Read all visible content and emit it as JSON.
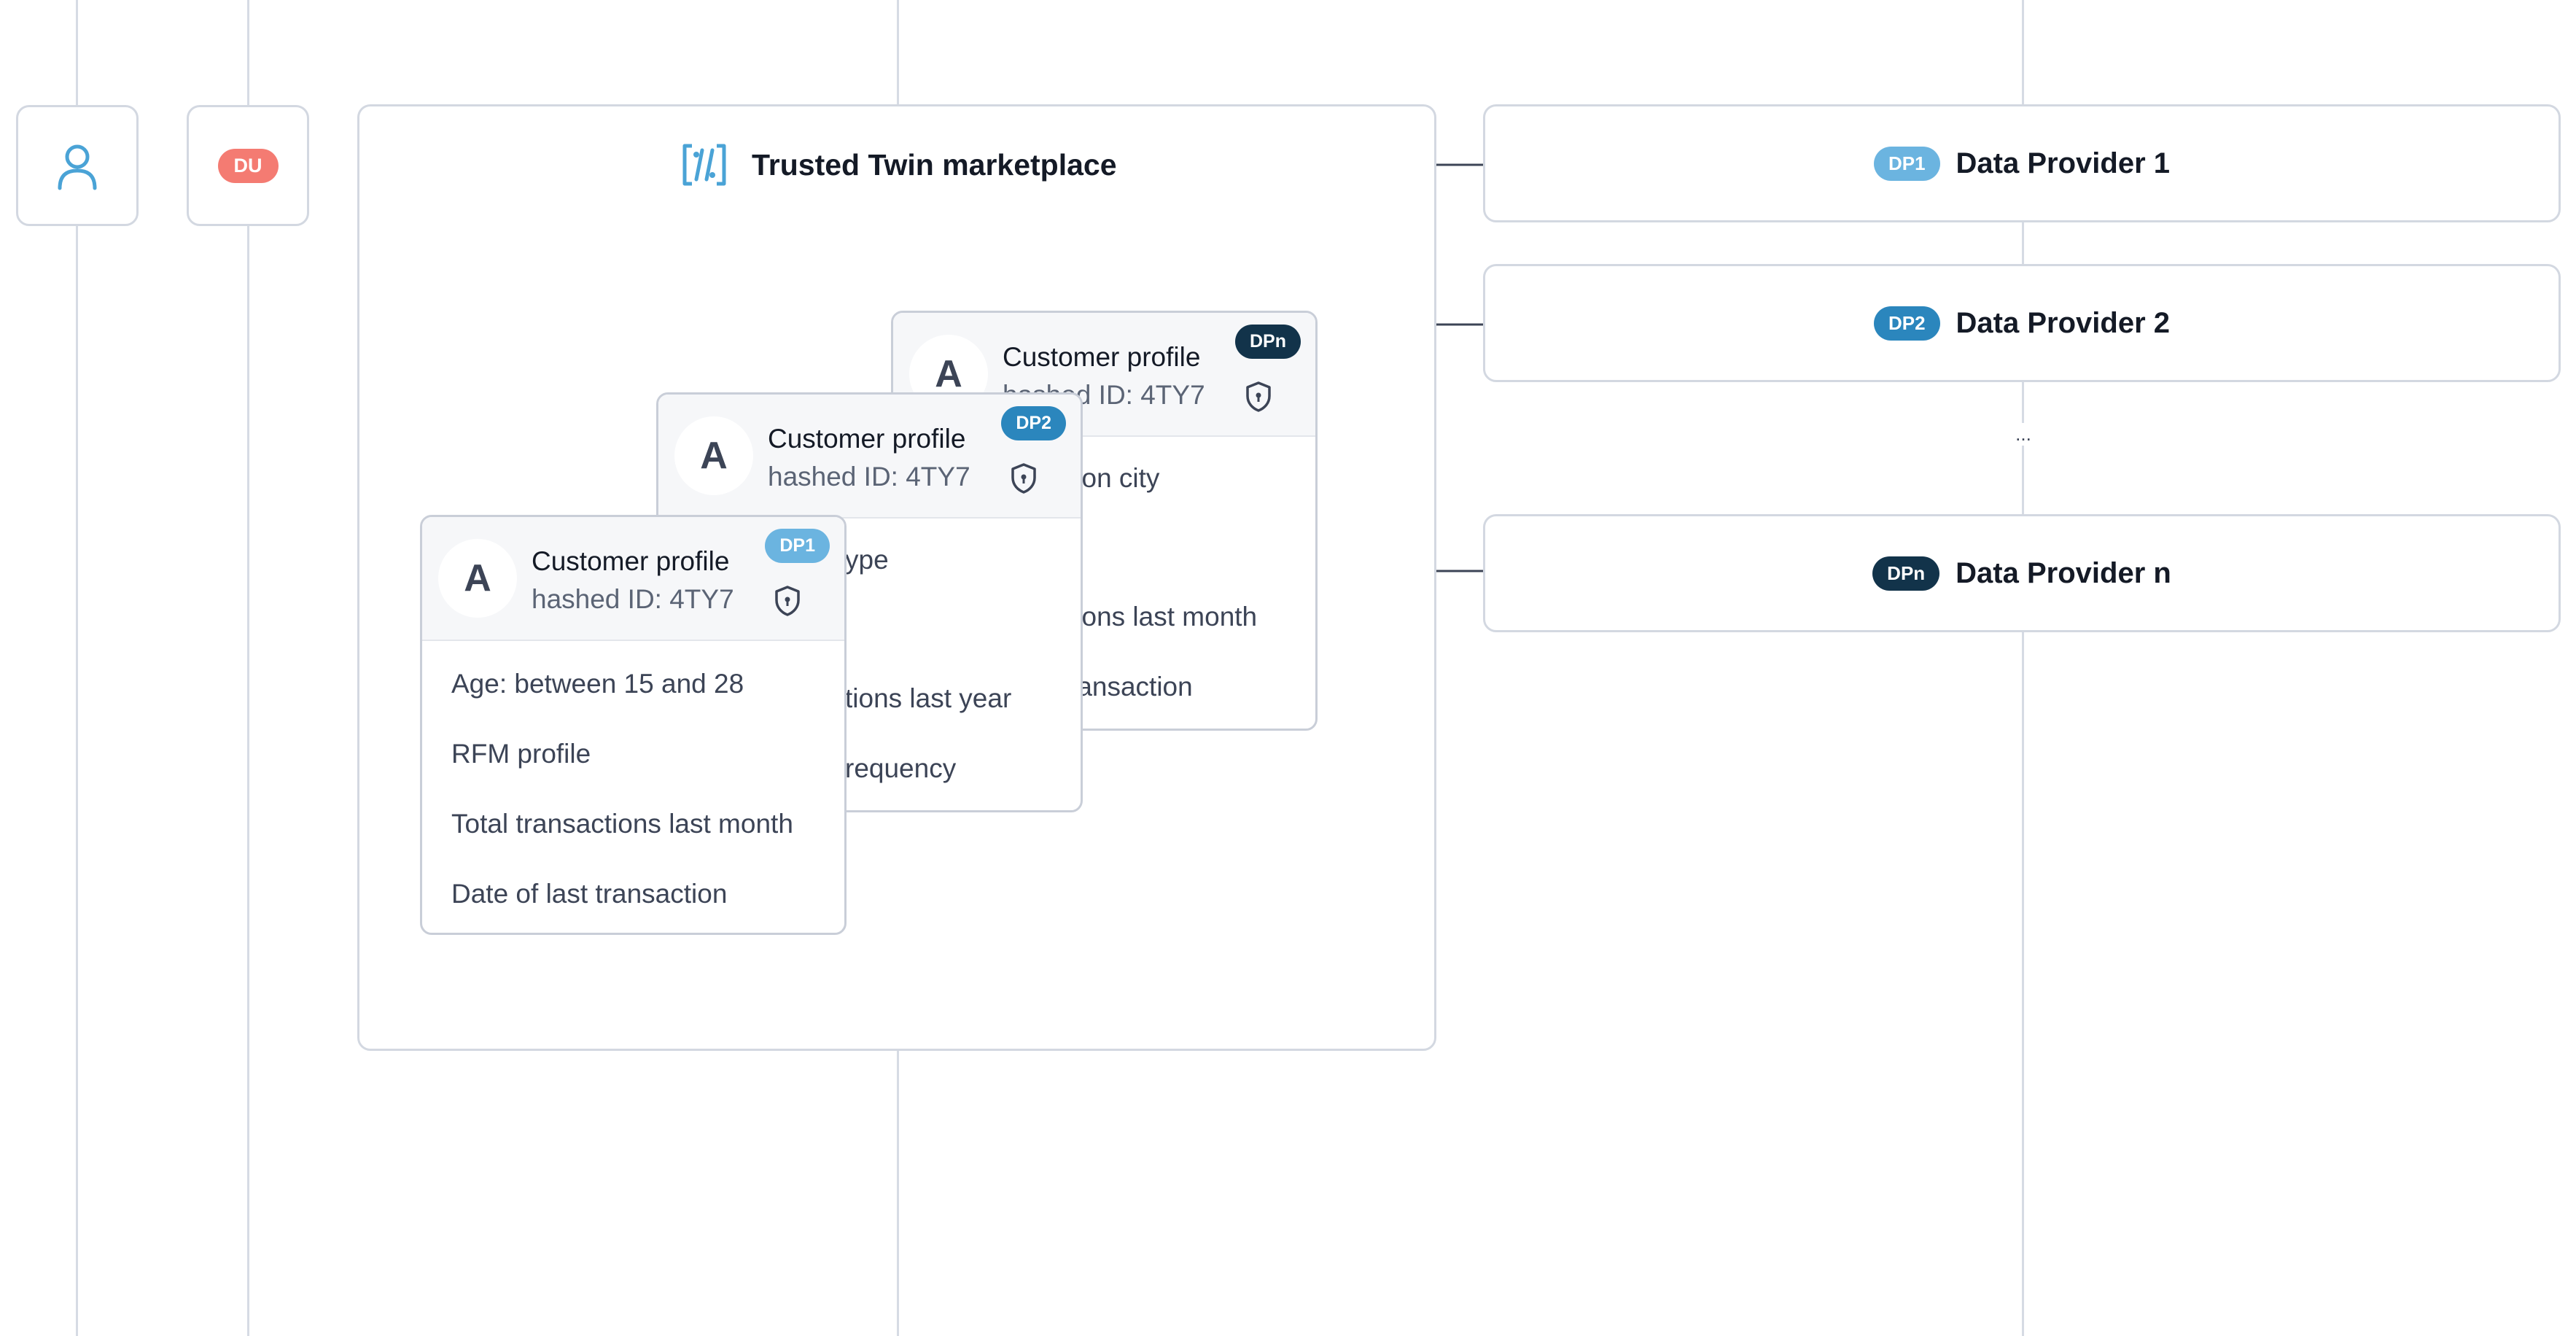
{
  "colors": {
    "lane": "#d6dbe4",
    "dp1": "#6bb4e0",
    "dp2": "#2b86bd",
    "dpn": "#12334a",
    "du": "#f47b72",
    "icon": "#4aa3d6"
  },
  "user_box": {
    "icon": "user-icon"
  },
  "du_box": {
    "badge": "DU"
  },
  "marketplace": {
    "icon": "trusted-twin-logo-icon",
    "title": "Trusted Twin marketplace",
    "cards": [
      {
        "badge": "DPn",
        "title": "Customer profile",
        "subtitle": "hashed ID: 4TY7",
        "avatar": "A",
        "visible_attributes": [
          "tion city",
          "tions last month",
          "ransaction"
        ]
      },
      {
        "badge": "DP2",
        "title": "Customer profile",
        "subtitle": "hashed ID: 4TY7",
        "avatar": "A",
        "visible_attributes": [
          "ype",
          "tions last year",
          "requency"
        ]
      },
      {
        "badge": "DP1",
        "title": "Customer profile",
        "subtitle": "hashed ID: 4TY7",
        "avatar": "A",
        "attributes": [
          "Age: between 15 and 28",
          "RFM profile",
          "Total transactions last month",
          "Date of last transaction"
        ]
      }
    ]
  },
  "providers": [
    {
      "badge": "DP1",
      "name": "Data Provider 1"
    },
    {
      "badge": "DP2",
      "name": "Data Provider 2"
    },
    {
      "ellipsis": "..."
    },
    {
      "badge": "DPn",
      "name": "Data Provider n"
    }
  ]
}
